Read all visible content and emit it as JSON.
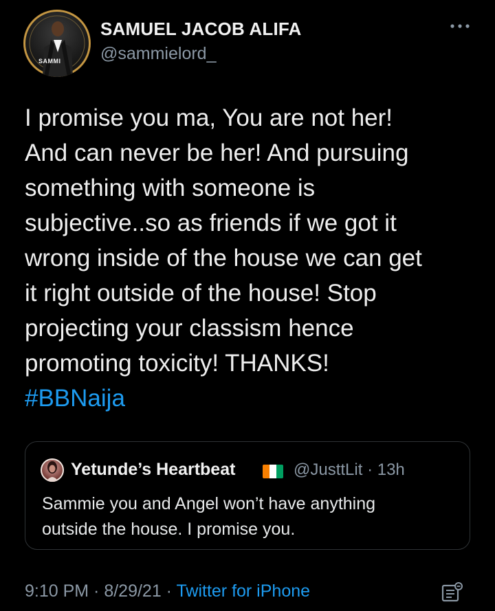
{
  "author": {
    "name": "SAMUEL JACOB ALIFA",
    "handle": "@sammielord_",
    "avatar_badge": "SAMMI"
  },
  "tweet": {
    "lines": [
      "I promise you ma, You are not her!",
      "And can never be her! And pursuing",
      "something with someone is",
      "subjective..so as friends if we got it",
      "wrong inside of the house we can get",
      "it right outside of the house! Stop",
      "projecting your classism hence",
      "promoting toxicity! THANKS!"
    ],
    "hashtag": "#BBNaija"
  },
  "quoted_tweet": {
    "name": "Yetunde’s Heartbeat",
    "flag_icon": "ivory-coast-flag-icon",
    "handle_time": "@JusttLit · 13h",
    "lines": [
      "Sammie you and Angel won’t have anything",
      "outside the house. I promise you."
    ]
  },
  "meta": {
    "time_date": "9:10 PM · 8/29/21 · ",
    "source": "Twitter for iPhone"
  },
  "icons": {
    "more": "more-horizontal-icon",
    "analytics": "view-analytics-icon"
  },
  "colors": {
    "background": "#000000",
    "link": "#1d9bf0",
    "muted": "#8b98a5",
    "text": "#e7e9ea"
  }
}
